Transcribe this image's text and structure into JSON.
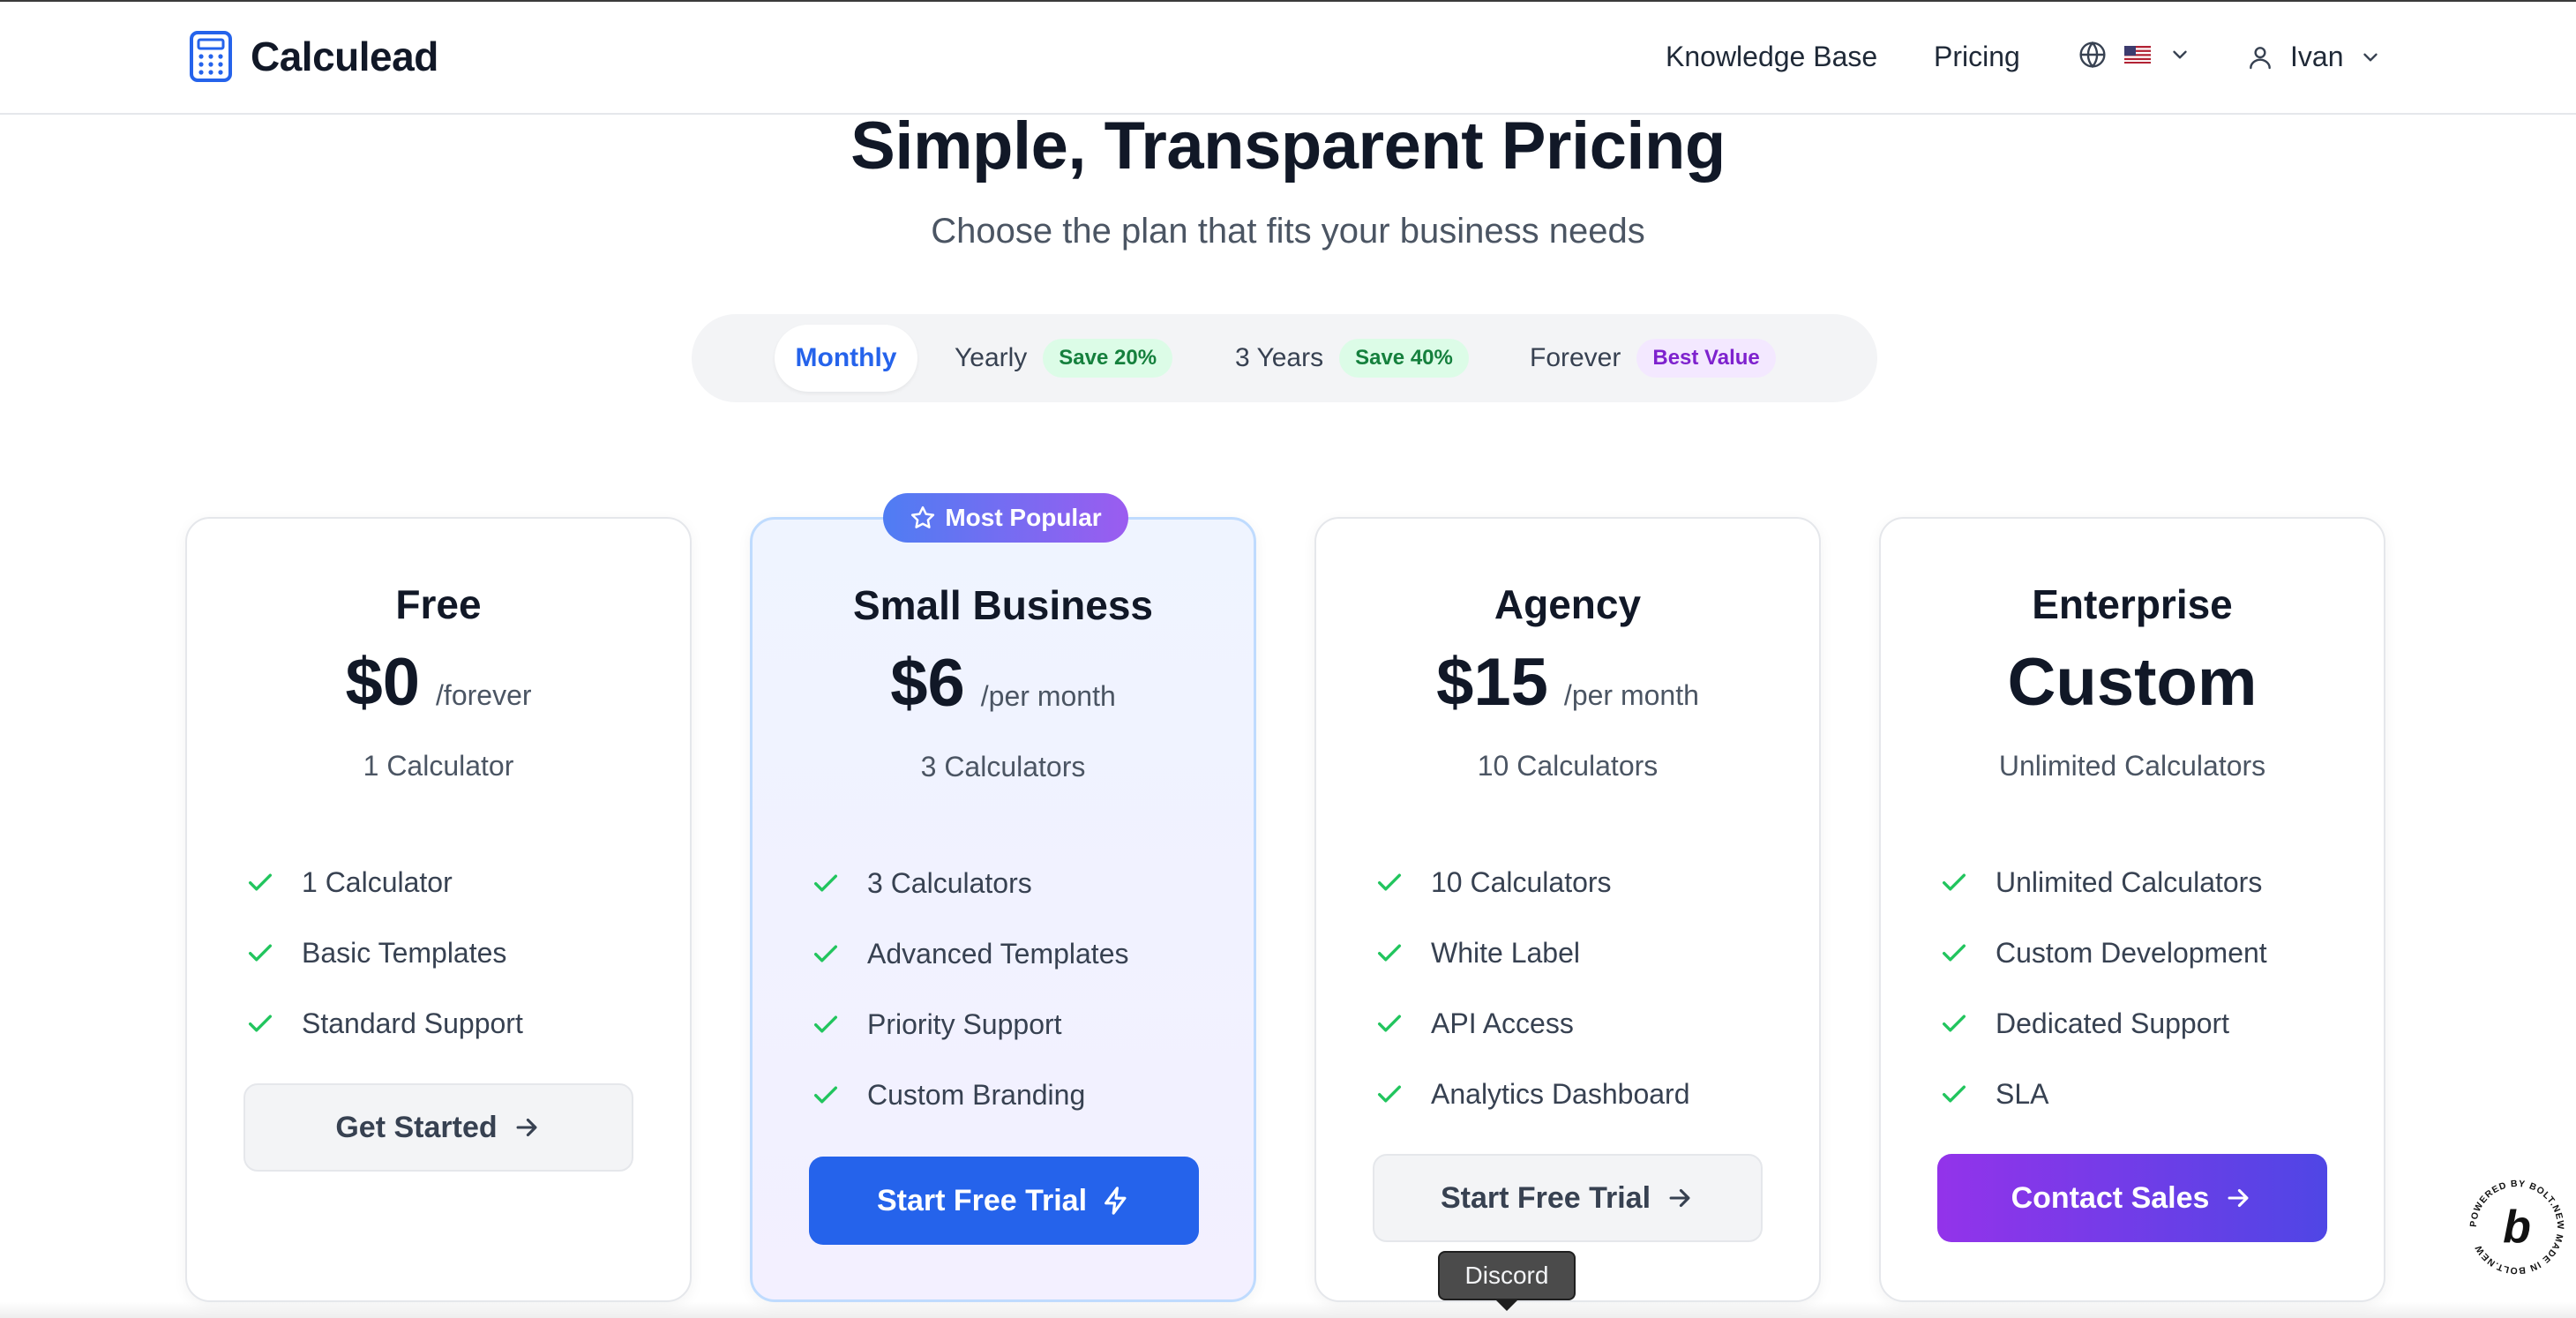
{
  "header": {
    "brand": "Calculead",
    "nav": {
      "knowledge_base": "Knowledge Base",
      "pricing": "Pricing"
    },
    "language": {
      "icon": "globe-icon",
      "flag": "us-flag"
    },
    "user": {
      "name": "Ivan",
      "icon": "user-icon"
    }
  },
  "hero": {
    "title": "Simple, Transparent Pricing",
    "subtitle": "Choose the plan that fits your business needs"
  },
  "billing_toggle": {
    "selected": "Monthly",
    "options": [
      {
        "label": "Monthly",
        "badge": ""
      },
      {
        "label": "Yearly",
        "badge": "Save 20%"
      },
      {
        "label": "3 Years",
        "badge": "Save 40%"
      },
      {
        "label": "Forever",
        "badge": "Best Value"
      }
    ]
  },
  "plans": [
    {
      "name": "Free",
      "price": "$0",
      "period": "/forever",
      "calculators": "1 Calculator",
      "features": [
        "1 Calculator",
        "Basic Templates",
        "Standard Support"
      ],
      "cta": "Get Started",
      "cta_icon": "arrow-right-icon"
    },
    {
      "name": "Small Business",
      "price": "$6",
      "period": "/per month",
      "calculators": "3 Calculators",
      "popular_badge": "Most Popular",
      "features": [
        "3 Calculators",
        "Advanced Templates",
        "Priority Support",
        "Custom Branding"
      ],
      "cta": "Start Free Trial",
      "cta_icon": "lightning-icon"
    },
    {
      "name": "Agency",
      "price": "$15",
      "period": "/per month",
      "calculators": "10 Calculators",
      "features": [
        "10 Calculators",
        "White Label",
        "API Access",
        "Analytics Dashboard"
      ],
      "cta": "Start Free Trial",
      "cta_icon": "arrow-right-icon"
    },
    {
      "name": "Enterprise",
      "price": "Custom",
      "period": "",
      "calculators": "Unlimited Calculators",
      "features": [
        "Unlimited Calculators",
        "Custom Development",
        "Dedicated Support",
        "SLA"
      ],
      "cta": "Contact Sales",
      "cta_icon": "arrow-right-icon"
    }
  ],
  "tooltip": "Discord",
  "bolt_badge": {
    "ring_text": "POWERED BY BOLT.NEW MADE IN BOLT.NEW",
    "letter": "b"
  },
  "colors": {
    "primary_blue": "#2563eb",
    "accent_purple": "#9333ea",
    "check_green": "#22c55e"
  }
}
